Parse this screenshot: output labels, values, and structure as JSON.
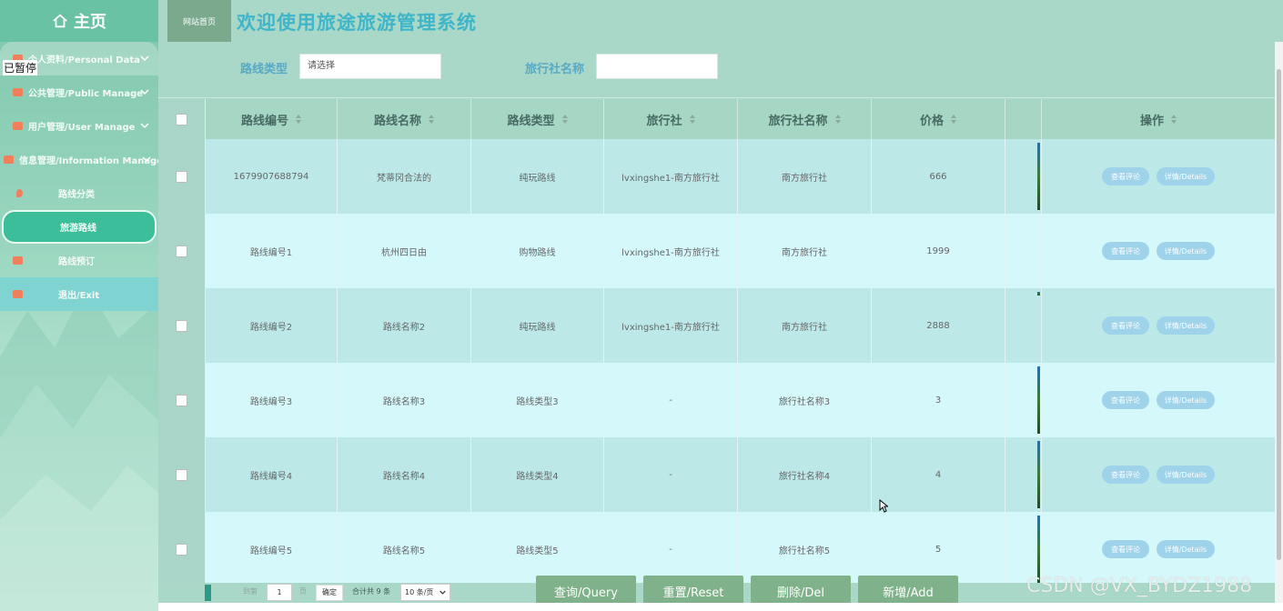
{
  "sidebar": {
    "home_label": "主页",
    "paused_label": "已暂停",
    "items": [
      {
        "label": "个人资料/Personal Data",
        "has_chevron": true
      },
      {
        "label": "公共管理/Public Manage",
        "has_chevron": true
      },
      {
        "label": "用户管理/User Manage",
        "has_chevron": true
      },
      {
        "label": "信息管理/Information Manage",
        "has_chevron": true
      },
      {
        "label": "路线分类"
      },
      {
        "label": "旅游路线",
        "active": true
      },
      {
        "label": "路线预订"
      },
      {
        "label": "退出/Exit"
      }
    ]
  },
  "topbar": {
    "site_button": "网站首页",
    "title": "欢迎使用旅途旅游管理系统"
  },
  "search": {
    "route_type_label": "路线类型",
    "route_type_placeholder": "请选择",
    "agency_name_label": "旅行社名称",
    "agency_name_value": ""
  },
  "table": {
    "headers": [
      "路线编号",
      "路线名称",
      "路线类型",
      "旅行社",
      "旅行社名称",
      "价格",
      "",
      "操作"
    ],
    "rows": [
      [
        "1679907688794",
        "梵蒂冈合法的",
        "纯玩路线",
        "lvxingshe1-南方旅行社",
        "南方旅行社",
        "666"
      ],
      [
        "路线编号1",
        "杭州四日由",
        "购物路线",
        "lvxingshe1-南方旅行社",
        "南方旅行社",
        "1999"
      ],
      [
        "路线编号2",
        "路线名称2",
        "纯玩路线",
        "lvxingshe1-南方旅行社",
        "南方旅行社",
        "2888"
      ],
      [
        "路线编号3",
        "路线名称3",
        "路线类型3",
        "-",
        "旅行社名称3",
        "3"
      ],
      [
        "路线编号4",
        "路线名称4",
        "路线类型4",
        "-",
        "旅行社名称4",
        "4"
      ],
      [
        "路线编号5",
        "路线名称5",
        "路线类型5",
        "-",
        "旅行社名称5",
        "5"
      ]
    ],
    "op_view_comments": "查看评论",
    "op_details": "详情/Details"
  },
  "pagination": {
    "goto_label": "到第",
    "page_value": "1",
    "page_unit": "页",
    "confirm": "确定",
    "total": "合计共 9 条",
    "page_size": "10 条/页"
  },
  "actions": {
    "query": "查询/Query",
    "reset": "重置/Reset",
    "delete": "删除/Del",
    "add": "新增/Add"
  },
  "watermark": "CSDN @VX_BYDZ1988"
}
